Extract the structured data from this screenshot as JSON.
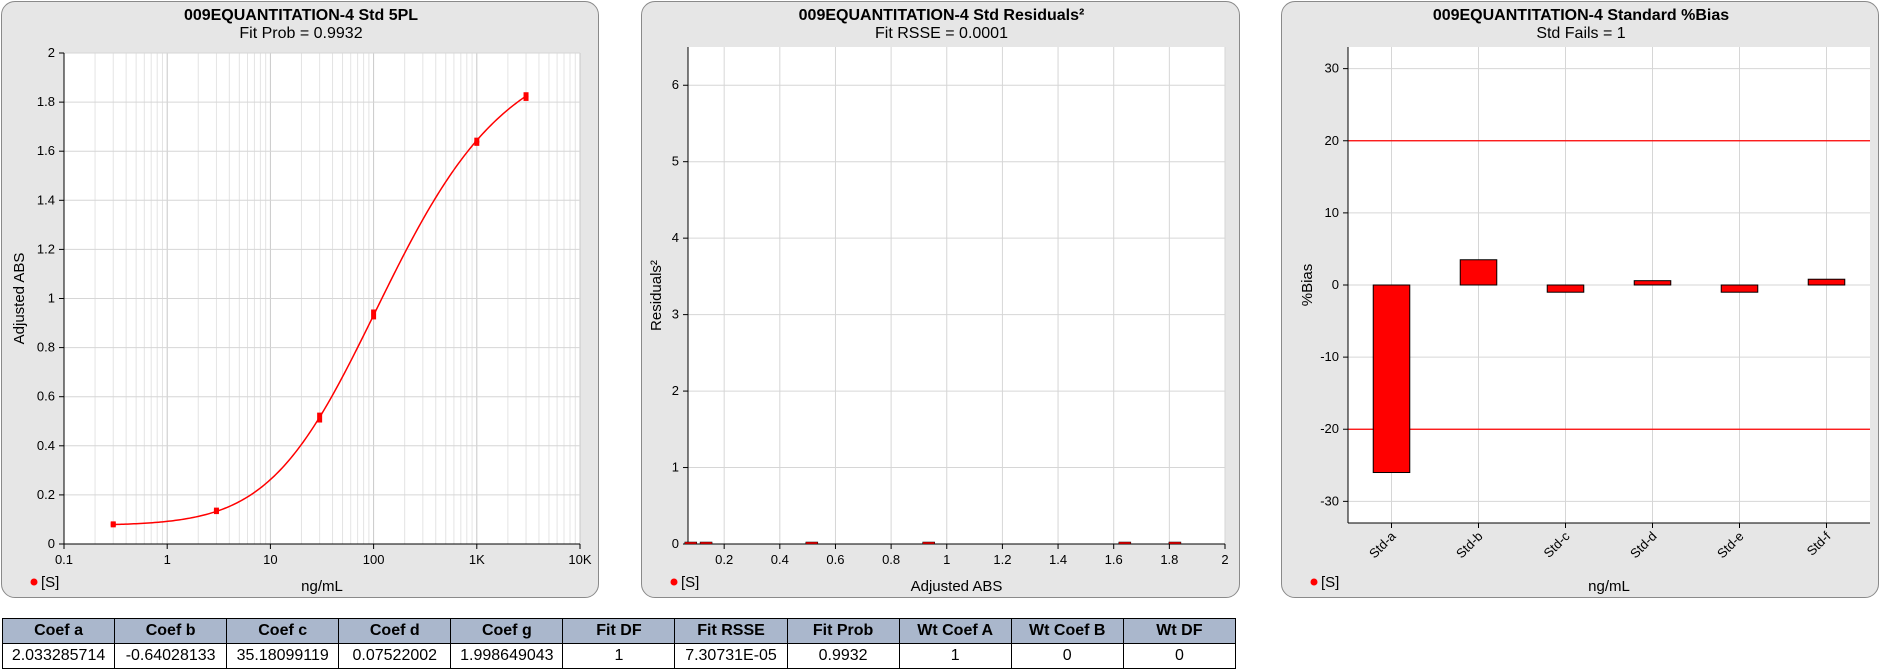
{
  "chart_data": [
    {
      "type": "line",
      "title": "009EQUANTITATION-4 Std 5PL",
      "subtitle": "Fit Prob = 0.9932",
      "xlabel": "ng/mL",
      "ylabel": "Adjusted ABS",
      "xscale": "log",
      "xlim": [
        0.1,
        10000
      ],
      "ylim": [
        0,
        2
      ],
      "x_ticks": [
        0.1,
        1,
        10,
        100,
        1000,
        10000
      ],
      "x_tick_labels": [
        "0.1",
        "1",
        "10",
        "100",
        "1K",
        "10K"
      ],
      "y_ticks": [
        0,
        0.2,
        0.4,
        0.6,
        0.8,
        1,
        1.2,
        1.4,
        1.6,
        1.8,
        2
      ],
      "y_tick_labels": [
        "0",
        "0.2",
        "0.4",
        "0.6",
        "0.8",
        "1",
        "1.2",
        "1.4",
        "1.6",
        "1.8",
        "2"
      ],
      "grid": true,
      "legend": "[S]",
      "legend_position": "bottom-left",
      "color": "#ff0000",
      "points": {
        "x": [
          0.3,
          0.3,
          3,
          3,
          30,
          30,
          100,
          100,
          1000,
          1000,
          3000,
          3000
        ],
        "y": [
          0.078,
          0.082,
          0.132,
          0.138,
          0.505,
          0.525,
          0.925,
          0.945,
          1.632,
          1.645,
          1.815,
          1.83
        ]
      },
      "curve_coefficients": {
        "a": 2.033285714,
        "b": -0.64028133,
        "c": 35.18099119,
        "d": 0.07522002,
        "g": 1.998649043
      }
    },
    {
      "type": "scatter",
      "title": "009EQUANTITATION-4 Std  Residuals²",
      "subtitle": "Fit RSSE = 0.0001",
      "xlabel": "Adjusted ABS",
      "ylabel": "Residuals²",
      "xlim": [
        0.07,
        2
      ],
      "ylim": [
        0,
        6.5
      ],
      "x_ticks": [
        0.2,
        0.4,
        0.6,
        0.8,
        1,
        1.2,
        1.4,
        1.6,
        1.8,
        2
      ],
      "x_tick_labels": [
        "0.2",
        "0.4",
        "0.6",
        "0.8",
        "1",
        "1.2",
        "1.4",
        "1.6",
        "1.8",
        "2"
      ],
      "y_ticks": [
        0,
        1,
        2,
        3,
        4,
        5,
        6
      ],
      "y_tick_labels": [
        "0",
        "1",
        "2",
        "3",
        "4",
        "5",
        "6"
      ],
      "grid": true,
      "legend": "[S]",
      "legend_position": "bottom-left",
      "color": "#ff0000",
      "x": [
        0.08,
        0.135,
        0.515,
        0.935,
        1.64,
        1.82
      ],
      "y": [
        0,
        0,
        0,
        0,
        0,
        0
      ]
    },
    {
      "type": "bar",
      "title": "009EQUANTITATION-4 Standard %Bias",
      "subtitle": "Std Fails = 1",
      "xlabel": "ng/mL",
      "ylabel": "%Bias",
      "ylim": [
        -33,
        33
      ],
      "y_ticks": [
        -30,
        -20,
        -10,
        0,
        10,
        20,
        30
      ],
      "y_tick_labels": [
        "-30",
        "-20",
        "-10",
        "0",
        "10",
        "20",
        "30"
      ],
      "grid": true,
      "limits": [
        20,
        -20
      ],
      "categories": [
        "Std-a",
        "Std-b",
        "Std-c",
        "Std-d",
        "Std-e",
        "Std-f"
      ],
      "values": [
        -26,
        3.5,
        -1,
        0.6,
        -1,
        0.8
      ],
      "legend": "[S]",
      "legend_position": "bottom-left",
      "color": "#ff0000"
    }
  ],
  "table": {
    "headers": [
      "Coef a",
      "Coef b",
      "Coef c",
      "Coef d",
      "Coef g",
      "Fit DF",
      "Fit RSSE",
      "Fit Prob",
      "Wt Coef A",
      "Wt Coef B",
      "Wt DF"
    ],
    "rows": [
      [
        "2.033285714",
        "-0.64028133",
        "35.18099119",
        "0.07522002",
        "1.998649043",
        "1",
        "7.30731E-05",
        "0.9932",
        "1",
        "0",
        "0"
      ]
    ]
  }
}
